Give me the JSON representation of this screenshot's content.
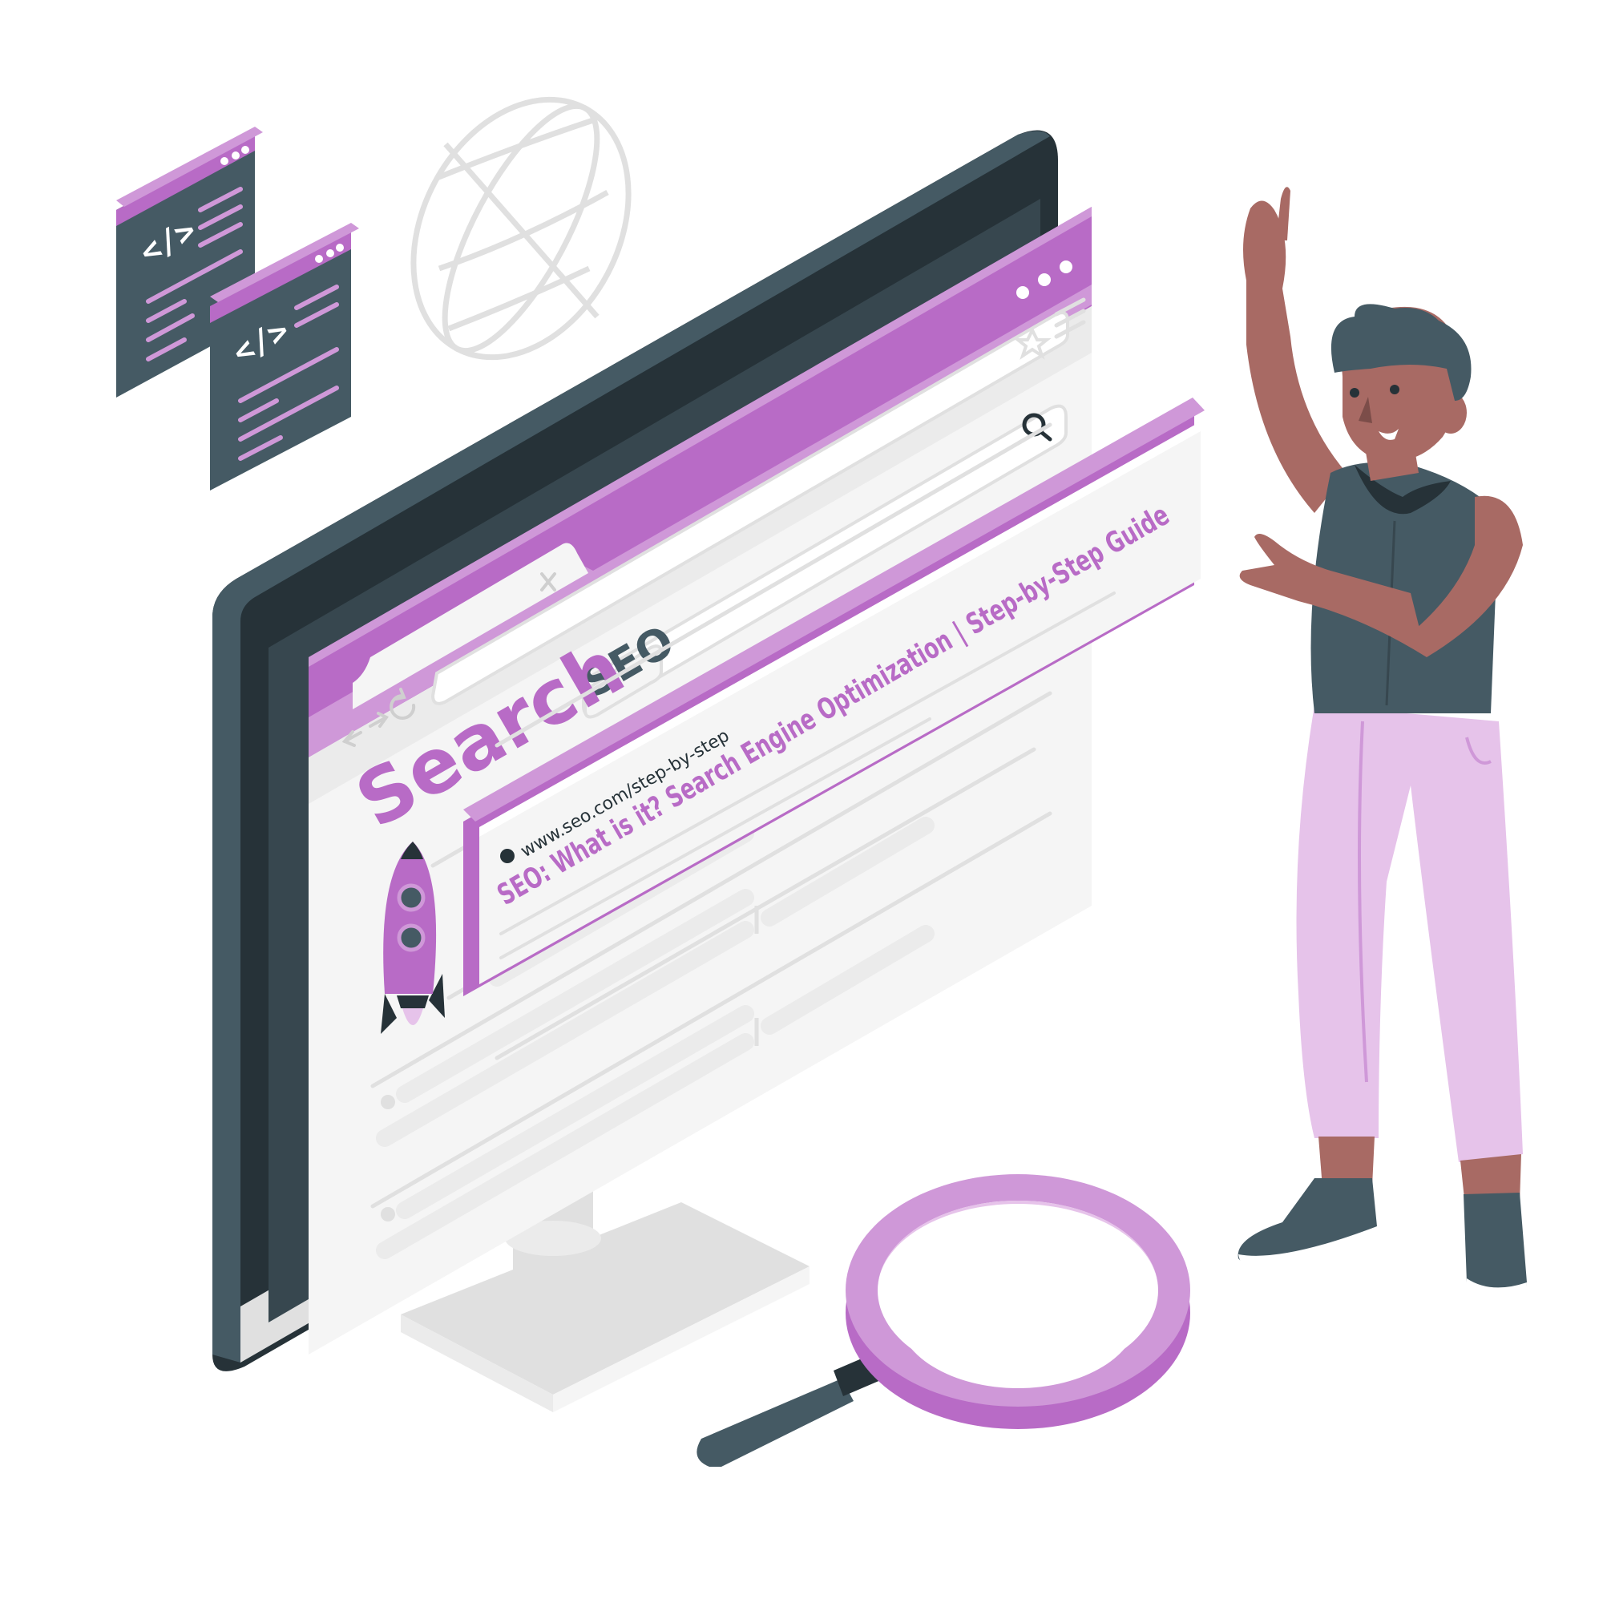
{
  "browser": {
    "search_heading": "Search",
    "query": "SEO"
  },
  "result": {
    "url": "www.seo.com/step-by-step",
    "title": "SEO: What is it? Search Engine Optimization | Step-by-Step Guide"
  },
  "code_windows": {
    "glyph": "</>"
  },
  "icons": {
    "globe": "globe-icon",
    "rocket": "rocket-icon",
    "magnifier": "magnifying-glass-icon",
    "star": "star-icon",
    "menu": "hamburger-menu-icon",
    "search": "search-icon",
    "back": "back-arrow-icon",
    "forward": "forward-arrow-icon",
    "reload": "reload-icon",
    "close": "close-tab-icon"
  },
  "colors": {
    "accent": "#b86bc6",
    "accent_light": "#cf98d8",
    "accent_pale": "#e6c3ea",
    "dark": "#455a64",
    "darker": "#263238",
    "skin": "#a86a64",
    "panel": "#f5f5f5",
    "line": "#e0e0e0"
  }
}
